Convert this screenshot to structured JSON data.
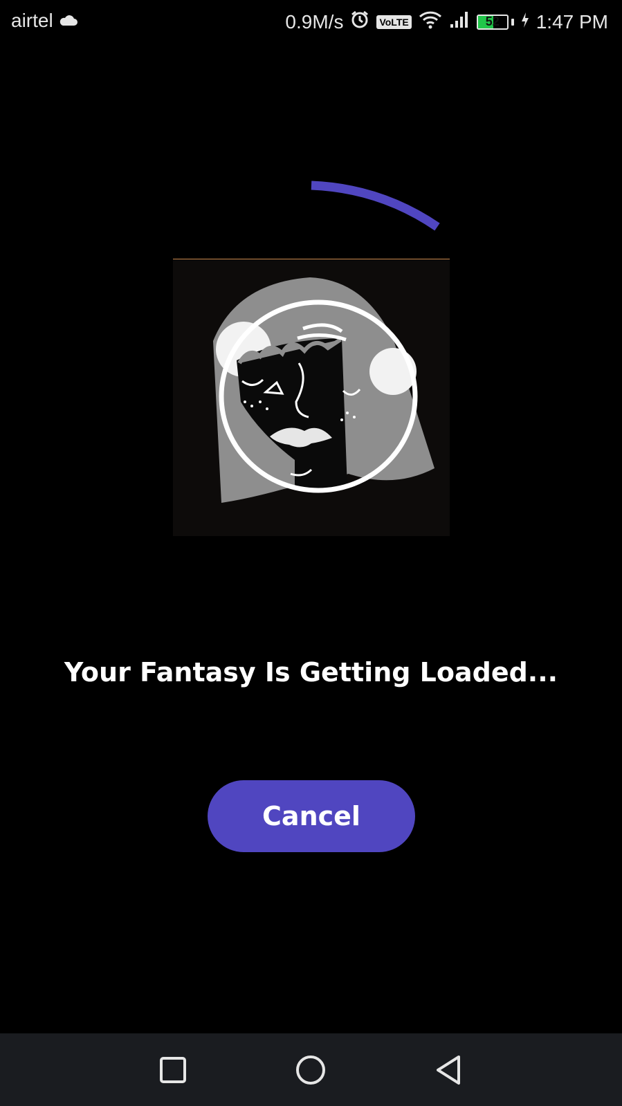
{
  "status_bar": {
    "carrier": "airtel",
    "speed": "0.9M/s",
    "volte": "VoLTE",
    "battery_level": "52",
    "battery_fraction": 0.52,
    "time": "1:47 PM",
    "icons": [
      "cloud-icon",
      "alarm-icon",
      "wifi-icon",
      "signal-icon",
      "charging-icon"
    ]
  },
  "main": {
    "title": "Your Fantasy Is Getting Loaded...",
    "cancel_label": "Cancel"
  },
  "navigation": {
    "buttons": [
      "recent-apps",
      "home",
      "back"
    ]
  },
  "colors": {
    "accent": "#5046c0",
    "background": "#000000",
    "nav_background": "#1a1c20"
  }
}
